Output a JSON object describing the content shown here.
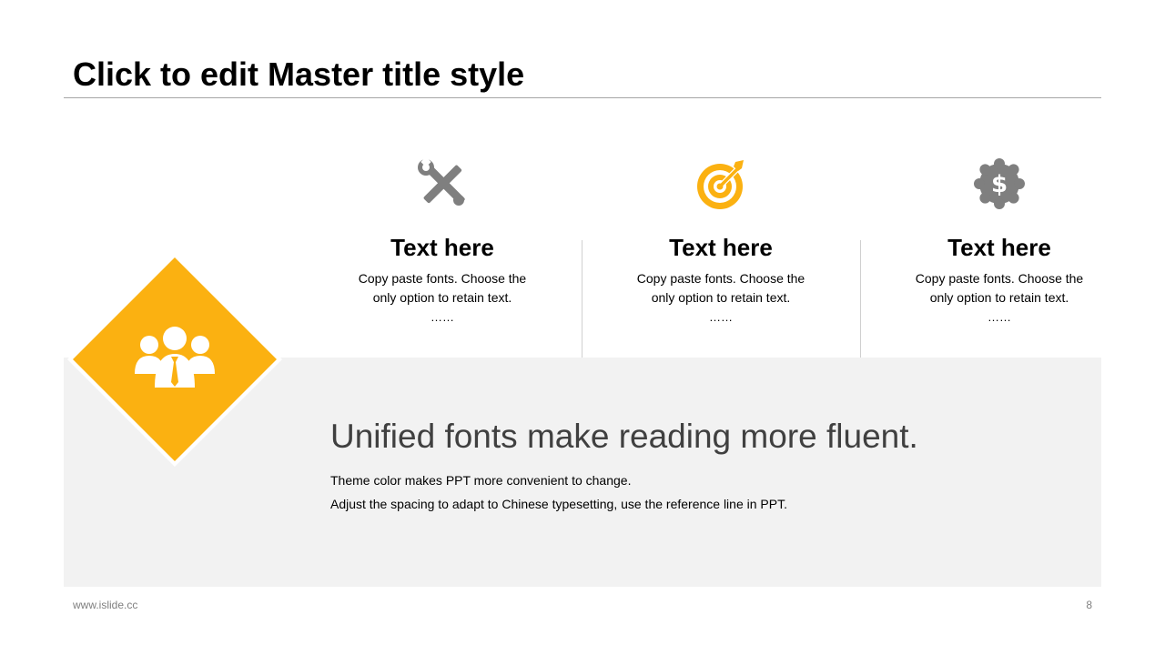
{
  "slide": {
    "title": "Click to edit Master title style",
    "colors": {
      "accent": "#FBB111",
      "icon_gray": "#7F7F7F",
      "panel": "#F2F2F2",
      "headline": "#404040"
    }
  },
  "features": [
    {
      "icon": "tools-icon",
      "title": "Text here",
      "description": "Copy paste fonts. Choose the only option to retain text.",
      "ellipsis": "……"
    },
    {
      "icon": "target-icon",
      "title": "Text here",
      "description": "Copy paste fonts. Choose the only option to retain text.",
      "ellipsis": "……"
    },
    {
      "icon": "dollar-badge-icon",
      "title": "Text here",
      "description": "Copy paste fonts. Choose the only option to retain text.",
      "ellipsis": "……"
    }
  ],
  "highlight": {
    "icon": "team-icon",
    "headline": "Unified fonts make reading more fluent.",
    "lines": [
      "Theme color makes PPT more convenient to change.",
      "Adjust the spacing to adapt to Chinese typesetting, use the reference line in PPT."
    ]
  },
  "footer": {
    "url": "www.islide.cc",
    "page_number": "8"
  }
}
